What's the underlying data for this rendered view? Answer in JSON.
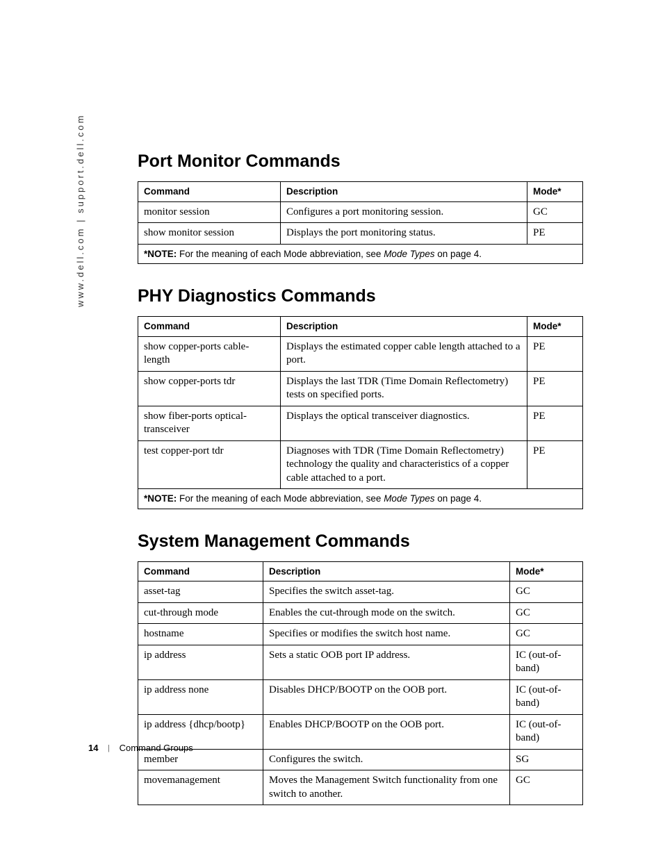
{
  "sideText": "www.dell.com | support.dell.com",
  "sections": [
    {
      "title": "Port Monitor Commands",
      "headers": {
        "c1": "Command",
        "c2": "Description",
        "c3": "Mode*"
      },
      "rows": [
        {
          "c1": "monitor session",
          "c2": "Configures a port monitoring session.",
          "c3": "GC"
        },
        {
          "c1": "show monitor session",
          "c2": "Displays the port monitoring status.",
          "c3": "PE"
        }
      ],
      "note": {
        "prefix": "*NOTE:",
        "text": " For the meaning of each Mode abbreviation, see ",
        "ital": "Mode Types",
        "suffix": " on page 4."
      }
    },
    {
      "title": "PHY Diagnostics Commands",
      "headers": {
        "c1": "Command",
        "c2": "Description",
        "c3": "Mode*"
      },
      "rows": [
        {
          "c1": "show copper-ports cable-length",
          "c2": "Displays the estimated copper cable length attached to a port.",
          "c3": "PE"
        },
        {
          "c1": "show copper-ports tdr",
          "c2": "Displays the last TDR (Time Domain Reflectometry) tests on specified ports.",
          "c3": "PE"
        },
        {
          "c1": "show fiber-ports optical-transceiver",
          "c2": "Displays the optical transceiver diagnostics.",
          "c3": "PE"
        },
        {
          "c1": "test copper-port tdr",
          "c2": "Diagnoses with TDR (Time Domain Reflectometry) technology the quality and characteristics of a copper cable attached to a port.",
          "c3": "PE"
        }
      ],
      "note": {
        "prefix": "*NOTE:",
        "text": " For the meaning of each Mode abbreviation, see ",
        "ital": "Mode Types",
        "suffix": " on page 4."
      }
    },
    {
      "title": "System Management Commands",
      "headers": {
        "c1": "Command",
        "c2": "Description",
        "c3": "Mode*"
      },
      "rows": [
        {
          "c1": "asset-tag",
          "c2": "Specifies the switch asset-tag.",
          "c3": "GC"
        },
        {
          "c1": "cut-through mode",
          "c2": "Enables the cut-through mode on the switch.",
          "c3": "GC"
        },
        {
          "c1": "hostname",
          "c2": "Specifies or modifies the switch host name.",
          "c3": "GC"
        },
        {
          "c1": "ip address",
          "c2": "Sets a static OOB port IP address.",
          "c3": "IC (out-of-band)"
        },
        {
          "c1": "ip address none",
          "c2": "Disables DHCP/BOOTP on the OOB port.",
          "c3": "IC (out-of-band)"
        },
        {
          "c1": "ip address {dhcp/bootp}",
          "c2": "Enables DHCP/BOOTP on the OOB port.",
          "c3": "IC (out-of-band)"
        },
        {
          "c1": "member",
          "c2": "Configures the switch.",
          "c3": "SG"
        },
        {
          "c1": "movemanagement",
          "c2": "Moves the Management Switch functionality from one switch to another.",
          "c3": "GC"
        }
      ]
    }
  ],
  "footer": {
    "page": "14",
    "section": "Command Groups"
  }
}
